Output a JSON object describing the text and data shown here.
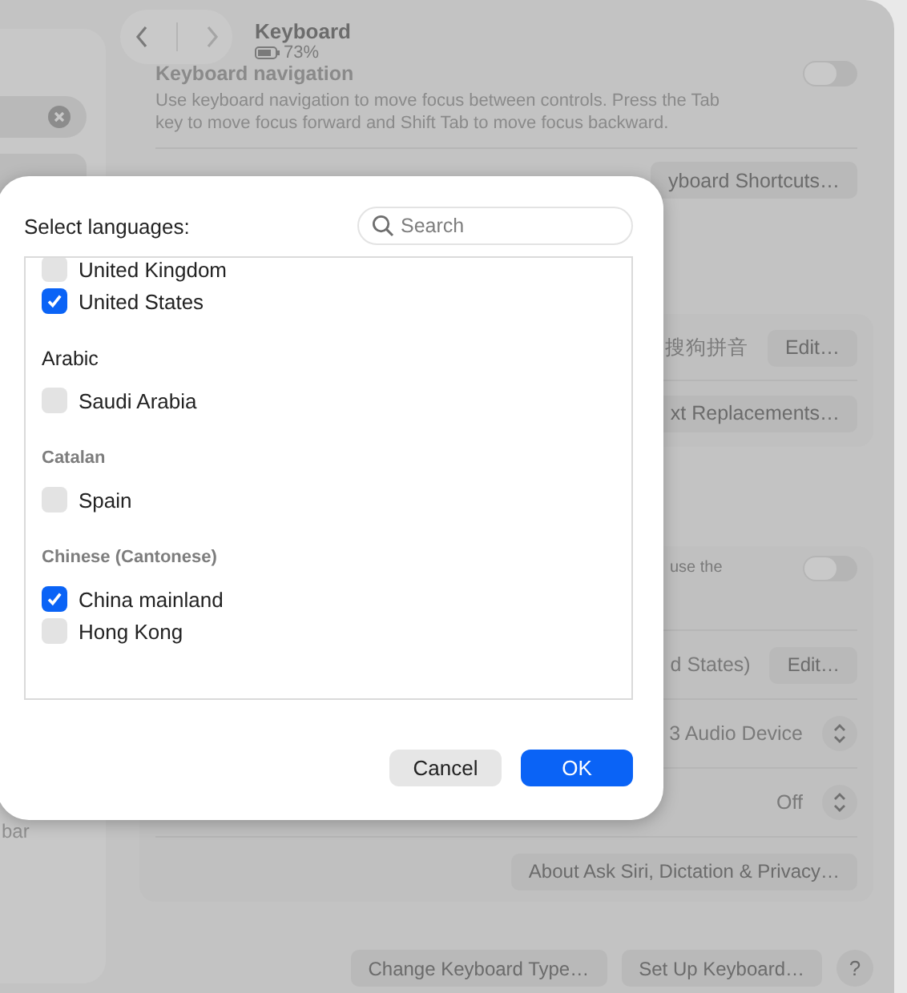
{
  "window": {
    "title": "Keyboard",
    "battery": "73%"
  },
  "sidebar": {
    "item_fragment": "bar"
  },
  "keyboard_navigation": {
    "label": "Keyboard navigation",
    "on": false,
    "description": "Use keyboard navigation to move focus between controls. Press the Tab key to move focus forward and Shift Tab to move focus backward.",
    "button": "yboard Shortcuts…"
  },
  "text_input": {
    "rows": [
      {
        "kind": "edit",
        "value": "搜狗拼音",
        "button": "Edit…"
      },
      {
        "kind": "button",
        "button": "xt Replacements…"
      }
    ]
  },
  "dictation": {
    "rows": [
      {
        "kind": "toggle",
        "label": "use the",
        "on": false
      },
      {
        "kind": "edit",
        "value": "d States)",
        "button": "Edit…"
      },
      {
        "kind": "popup",
        "value": "3 Audio Device"
      },
      {
        "kind": "popup",
        "value": "Off"
      },
      {
        "kind": "button",
        "button": "About Ask Siri, Dictation & Privacy…"
      }
    ]
  },
  "footer_buttons": [
    {
      "kind": "text",
      "label": "Change Keyboard Type…"
    },
    {
      "kind": "text",
      "label": "Set Up Keyboard…"
    },
    {
      "kind": "help",
      "label": "?"
    }
  ],
  "dialog": {
    "title": "Select languages:",
    "search": {
      "placeholder": "Search"
    },
    "groups": [
      {
        "items": [
          {
            "label": "United Kingdom",
            "checked": false
          },
          {
            "label": "United States",
            "checked": true
          }
        ]
      },
      {
        "heading": "Arabic",
        "kind": "plain",
        "items": [
          {
            "label": "Saudi Arabia",
            "checked": false
          }
        ]
      },
      {
        "heading": "Catalan",
        "kind": "section",
        "items": [
          {
            "label": "Spain",
            "checked": false
          }
        ]
      },
      {
        "heading": "Chinese (Cantonese)",
        "kind": "section",
        "items": [
          {
            "label": "China mainland",
            "checked": true
          },
          {
            "label": "Hong Kong",
            "checked": false
          }
        ]
      }
    ],
    "buttons": [
      {
        "label": "Cancel",
        "kind": "secondary"
      },
      {
        "label": "OK",
        "kind": "primary"
      }
    ]
  }
}
